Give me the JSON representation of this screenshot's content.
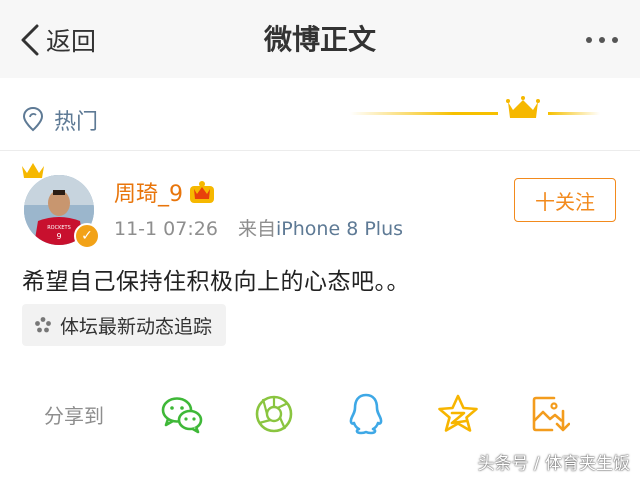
{
  "nav": {
    "back_label": "返回",
    "title": "微博正文"
  },
  "hot": {
    "label": "热门"
  },
  "post": {
    "username": "周琦_9",
    "time": "11-1 07:26",
    "source_prefix": "来自",
    "source": "iPhone 8 Plus",
    "follow_label": "十关注",
    "text": "希望自己保持住积极向上的心态吧。。",
    "topic": "体坛最新动态追踪",
    "avatar_jersey_text": "ROCKETS",
    "avatar_jersey_number": "9"
  },
  "share": {
    "label": "分享到",
    "targets": [
      "wechat-icon",
      "moments-icon",
      "qq-icon",
      "qzone-icon",
      "save-image-icon"
    ]
  },
  "watermark": "头条号 / 体育夹生饭",
  "colors": {
    "accent_orange": "#e8750b",
    "link_blue": "#5e7a95",
    "wechat_green": "#3fb838",
    "moments_green": "#8ac540",
    "qq_blue": "#3ea8e6",
    "qzone_yellow": "#f7b500",
    "save_orange": "#f39c1d"
  }
}
